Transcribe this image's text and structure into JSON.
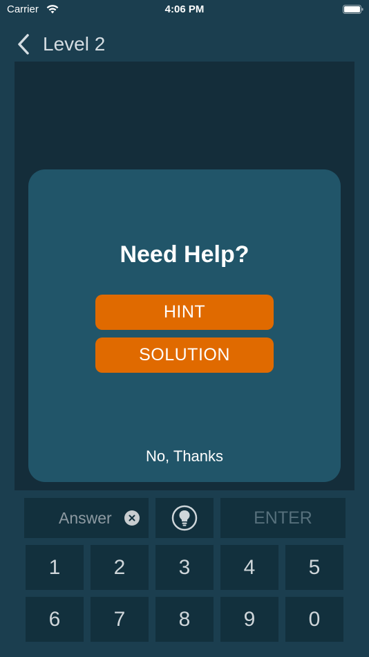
{
  "status_bar": {
    "carrier": "Carrier",
    "time": "4:06 PM",
    "wifi_icon": "wifi-icon",
    "battery_icon": "battery-icon"
  },
  "nav": {
    "back_icon": "chevron-left-icon",
    "title": "Level 2"
  },
  "modal": {
    "title": "Need Help?",
    "hint_label": "HINT",
    "solution_label": "SOLUTION",
    "dismiss_label": "No, Thanks"
  },
  "input": {
    "placeholder": "Answer",
    "clear_icon": "clear-icon",
    "hint_icon": "lightbulb-icon",
    "enter_label": "ENTER"
  },
  "keypad": {
    "keys": [
      "1",
      "2",
      "3",
      "4",
      "5",
      "6",
      "7",
      "8",
      "9",
      "0"
    ]
  },
  "colors": {
    "background": "#1b3e4f",
    "puzzle_area": "#142d3a",
    "modal": "#215569",
    "accent": "#e06a00",
    "key": "#12303d"
  }
}
